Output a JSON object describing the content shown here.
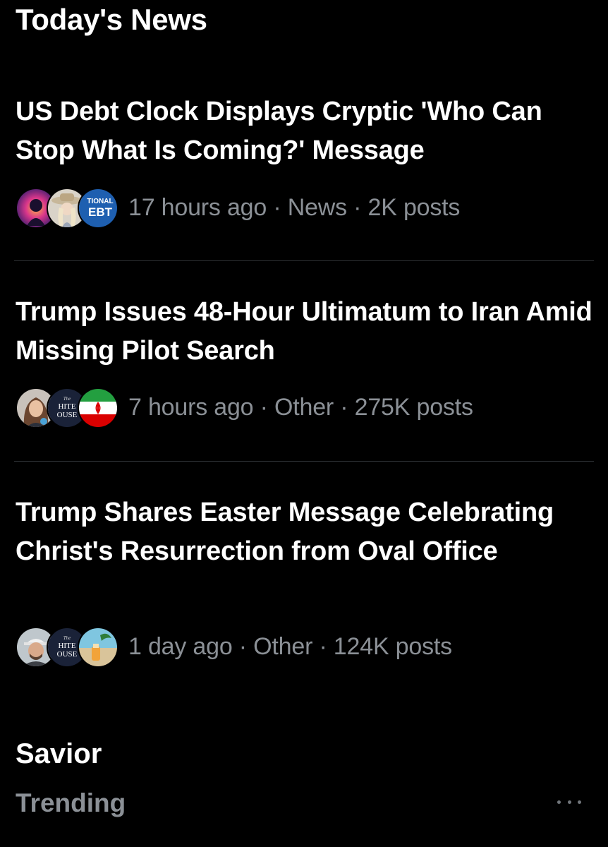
{
  "section": {
    "title": "Today's News"
  },
  "stories": [
    {
      "headline": "US Debt Clock Displays Cryptic 'Who Can Stop What Is Coming?' Message",
      "meta": "17 hours ago · News · 2K posts",
      "avatars": [
        "abstract-portrait-avatar",
        "cowgirl-hat-avatar",
        "national-debt-logo-avatar"
      ],
      "avatar_text": [
        "TIONAL",
        "EBT"
      ]
    },
    {
      "headline": "Trump Issues 48-Hour Ultimatum to Iran Amid Missing Pilot Search",
      "meta": "7 hours ago · Other · 275K posts",
      "avatars": [
        "woman-portrait-avatar",
        "white-house-logo-avatar",
        "iran-flag-avatar"
      ],
      "avatar_text": [
        "The",
        "HITE",
        "OUSE"
      ]
    },
    {
      "headline": "Trump Shares Easter Message Celebrating Christ's Resurrection from Oval Office",
      "meta": "1 day ago · Other · 124K posts",
      "avatars": [
        "man-cap-portrait-avatar",
        "white-house-logo-avatar",
        "beach-drink-avatar"
      ],
      "avatar_text": [
        "The",
        "HITE",
        "OUSE"
      ]
    }
  ],
  "trend": {
    "title": "Savior",
    "subtitle": "Trending",
    "more_icon": "more-horizontal-icon"
  },
  "colors": {
    "background": "#000000",
    "headline": "#ffffff",
    "muted": "#8b9096",
    "divider": "#2f3336"
  }
}
